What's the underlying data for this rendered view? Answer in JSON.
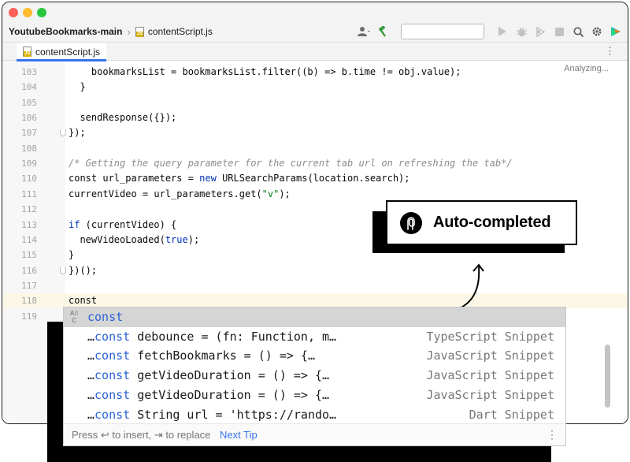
{
  "window": {
    "project": "YoutubeBookmarks-main",
    "file": "contentScript.js"
  },
  "tabs": [
    {
      "label": "contentScript.js",
      "active": true
    }
  ],
  "editor": {
    "status": "Analyzing...",
    "lines": [
      {
        "num": "103",
        "parts": [
          {
            "t": "    bookmarksList = bookmarksList.filter((b) => b.time != obj.value);",
            "c": ""
          }
        ]
      },
      {
        "num": "104",
        "parts": [
          {
            "t": "  }",
            "c": ""
          }
        ]
      },
      {
        "num": "105",
        "parts": []
      },
      {
        "num": "106",
        "parts": [
          {
            "t": "  sendResponse({});",
            "c": ""
          }
        ]
      },
      {
        "num": "107",
        "parts": [
          {
            "t": "});",
            "c": ""
          }
        ]
      },
      {
        "num": "108",
        "parts": []
      },
      {
        "num": "109",
        "parts": [
          {
            "t": "/* Getting the query parameter for the current tab url on refreshing the tab*/",
            "c": "cm"
          }
        ]
      },
      {
        "num": "110",
        "parts": [
          {
            "t": "const url_parameters = ",
            "c": ""
          },
          {
            "t": "new",
            "c": "kw"
          },
          {
            "t": " URLSearchParams(location.search);",
            "c": ""
          }
        ]
      },
      {
        "num": "111",
        "parts": [
          {
            "t": "currentVideo = url_parameters.get(",
            "c": ""
          },
          {
            "t": "\"v\"",
            "c": "str"
          },
          {
            "t": ");",
            "c": ""
          }
        ]
      },
      {
        "num": "112",
        "parts": []
      },
      {
        "num": "113",
        "parts": [
          {
            "t": "if",
            "c": "kw"
          },
          {
            "t": " (currentVideo) {",
            "c": ""
          }
        ]
      },
      {
        "num": "114",
        "parts": [
          {
            "t": "  newVideoLoaded(",
            "c": ""
          },
          {
            "t": "true",
            "c": "kw"
          },
          {
            "t": ");",
            "c": ""
          }
        ]
      },
      {
        "num": "115",
        "parts": [
          {
            "t": "}",
            "c": ""
          }
        ]
      },
      {
        "num": "116",
        "parts": [
          {
            "t": "})();",
            "c": ""
          }
        ]
      },
      {
        "num": "117",
        "parts": []
      },
      {
        "num": "118",
        "parts": [
          {
            "t": "const",
            "c": ""
          }
        ]
      },
      {
        "num": "119",
        "parts": []
      }
    ]
  },
  "autocomplete": {
    "items": [
      {
        "prefix": "",
        "keyword": "const",
        "rest": "",
        "type": ""
      },
      {
        "prefix": "…",
        "keyword": "const",
        "rest": " debounce = (fn: Function, m…",
        "type": "TypeScript Snippet"
      },
      {
        "prefix": "…",
        "keyword": "const",
        "rest": " fetchBookmarks = () => {…",
        "type": "JavaScript Snippet"
      },
      {
        "prefix": "…",
        "keyword": "const",
        "rest": " getVideoDuration = () => {…",
        "type": "JavaScript Snippet"
      },
      {
        "prefix": "…",
        "keyword": "const",
        "rest": " getVideoDuration = () => {…",
        "type": "JavaScript Snippet"
      },
      {
        "prefix": "…",
        "keyword": "const",
        "rest": " String url = 'https://rando…",
        "type": "Dart Snippet"
      }
    ],
    "abc_icon": "ABC",
    "footer_hint": "Press ↩ to insert, ⇥ to replace",
    "footer_link": "Next Tip",
    "footer_menu": "⋮"
  },
  "callout": {
    "label": "Auto-completed"
  },
  "icons": [
    "user-icon",
    "hammer-icon",
    "run-icon",
    "debug-icon",
    "coverage-icon",
    "stop-icon",
    "search-icon",
    "gear-icon",
    "plugin-icon"
  ]
}
